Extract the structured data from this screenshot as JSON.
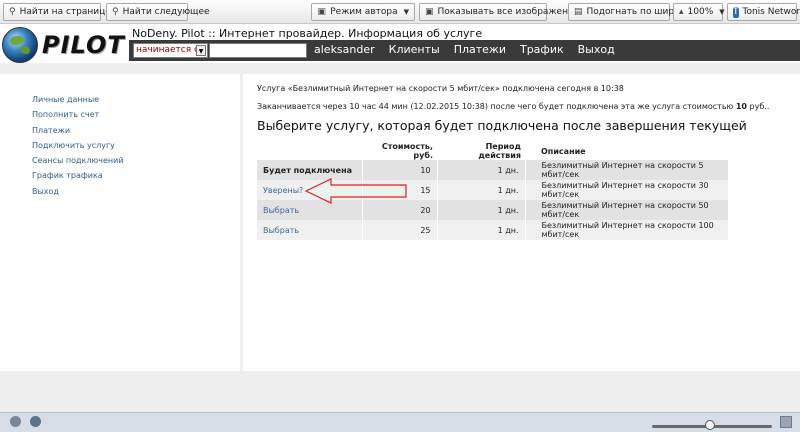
{
  "toolbar": {
    "find_placeholder": "Найти на странице",
    "find_next": "Найти следующее",
    "author_mode": "Режим автора",
    "show_images": "Показывать все изображения",
    "fit_width": "Подогнать по ширине",
    "zoom": "100%",
    "network": "Tonis Network"
  },
  "site": {
    "logo_text": "PILOT",
    "page_title": "NoDeny. Pilot :: Интернет провайдер. Информация об услуге"
  },
  "navbar": {
    "search_mode": "начинается с",
    "items": [
      "aleksander",
      "Клиенты",
      "Платежи",
      "Трафик",
      "Выход"
    ]
  },
  "sidebar": {
    "items": [
      "Личные данные",
      "Пополнить счет",
      "Платежи",
      "Подключить услугу",
      "Сеансы подключений",
      "График трафика",
      "Выход"
    ]
  },
  "main": {
    "info1": "Услуга «Безлимитный Интернет на скорости 5 мбит/сек» подключена сегодня в 10:38",
    "info2_prefix": "Заканчивается через 10 час 44 мин (12.02.2015 10:38) после чего будет подключена эта же услуга стоимостью ",
    "info2_price": "10",
    "info2_suffix": " руб..",
    "heading": "Выберите услугу, которая будет подключена после завершения текущей",
    "table": {
      "headers": [
        "",
        "Стоимость, руб.",
        "Период действия",
        "Описание"
      ],
      "rows": [
        {
          "action": "Будет подключена",
          "price": "10",
          "period": "1 дн.",
          "desc": "Безлимитный Интернет на скорости 5 мбит/сек"
        },
        {
          "action": "Уверены?",
          "price": "15",
          "period": "1 дн.",
          "desc": "Безлимитный Интернет на скорости 30 мбит/сек"
        },
        {
          "action": "Выбрать",
          "price": "20",
          "period": "1 дн.",
          "desc": "Безлимитный Интернет на скорости 50 мбит/сек"
        },
        {
          "action": "Выбрать",
          "price": "25",
          "period": "1 дн.",
          "desc": "Безлимитный Интернет на скорости 100 мбит/сек"
        }
      ]
    }
  },
  "colors": {
    "navbar_bg": "#3a3a3a",
    "link": "#3d6b9a",
    "arrow": "#d9241c"
  }
}
